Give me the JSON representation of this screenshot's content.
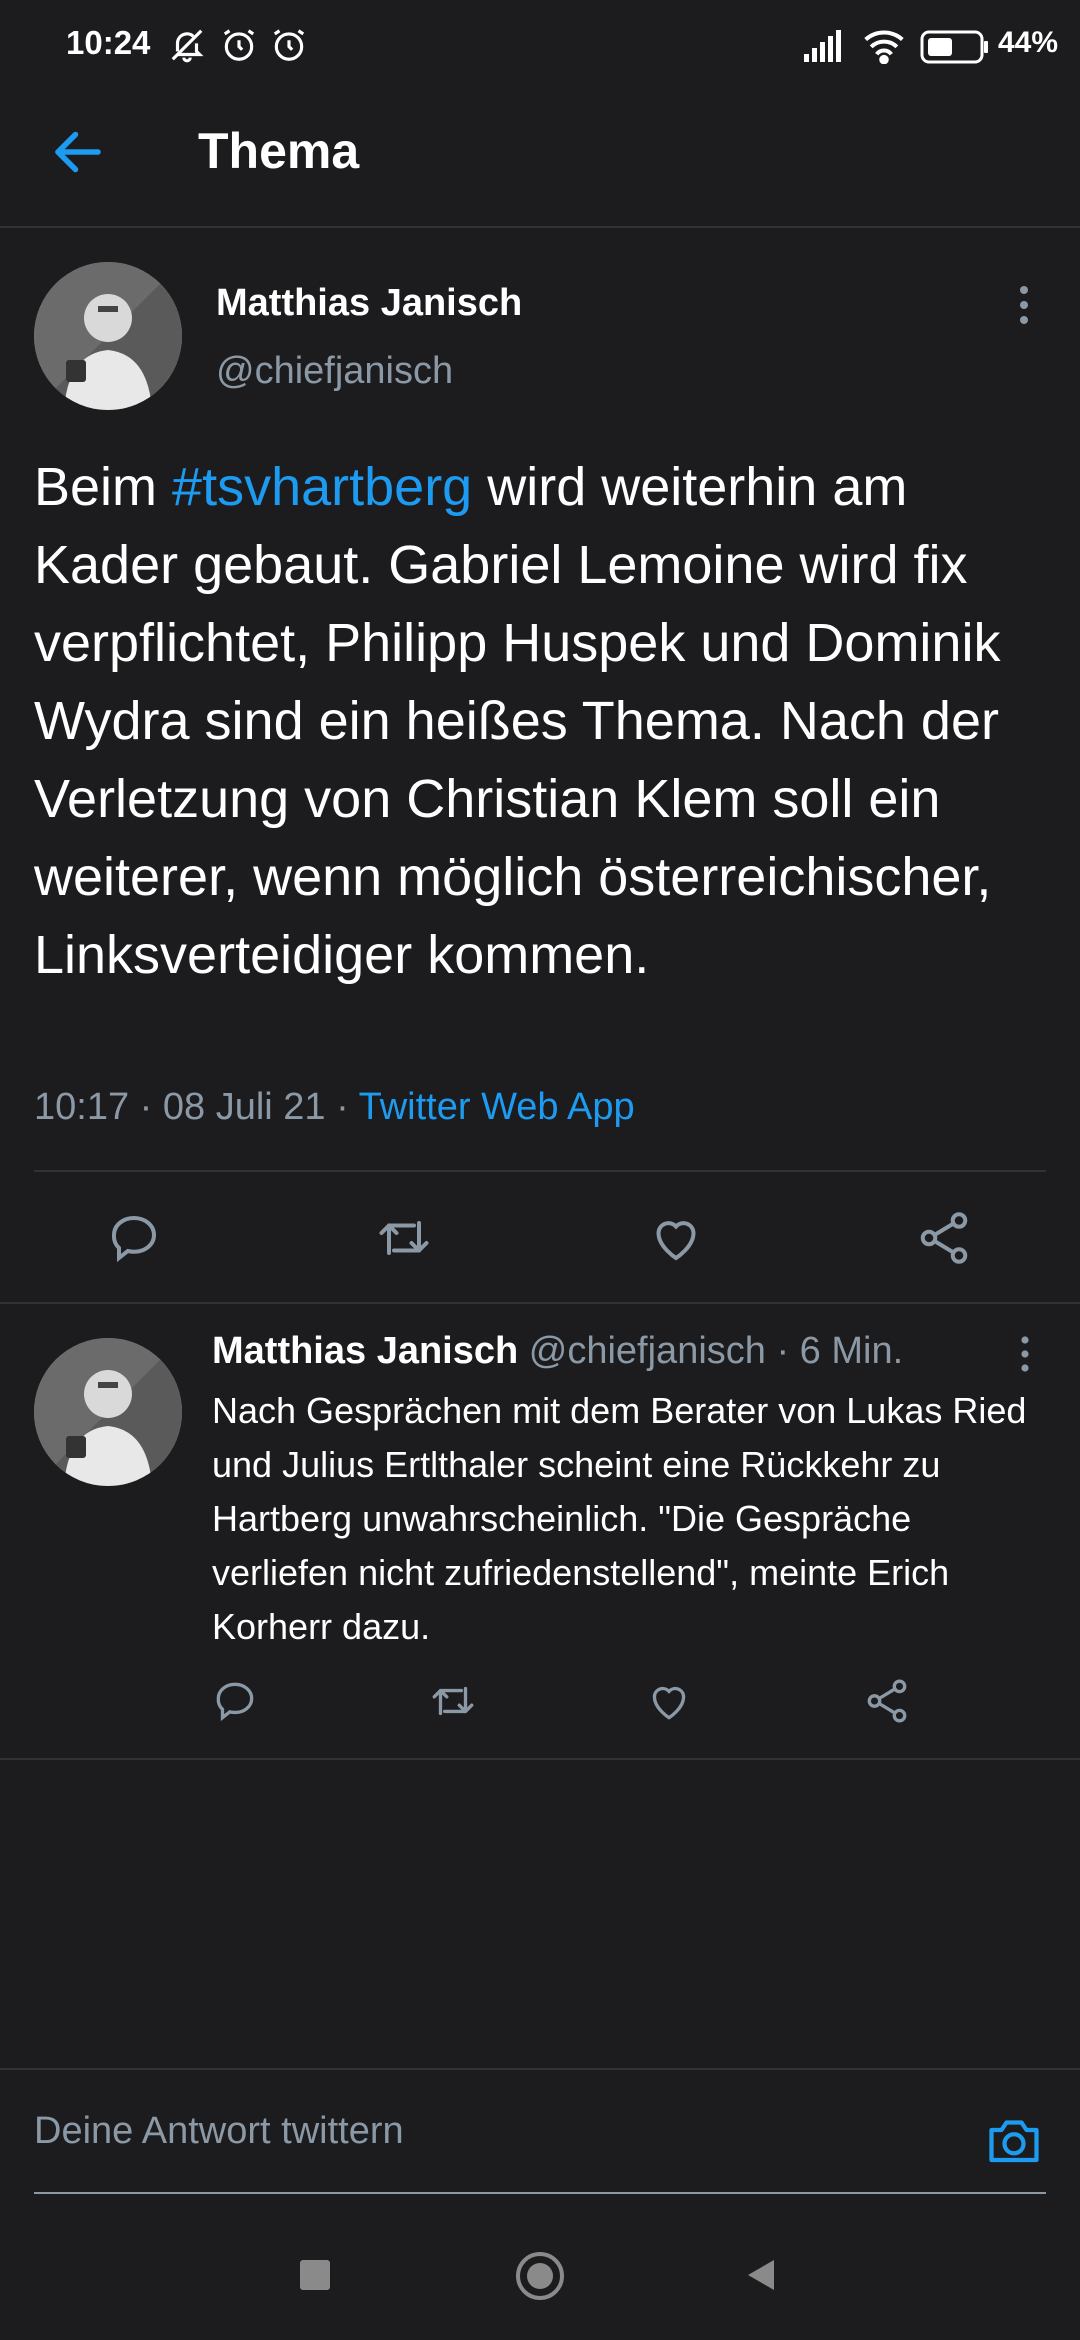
{
  "status_bar": {
    "time": "10:24",
    "battery_percent": "44%",
    "icons": [
      "notifications-off-icon",
      "alarm-icon",
      "alarm-icon",
      "signal-icon",
      "wifi-icon",
      "battery-icon"
    ]
  },
  "header": {
    "title": "Thema",
    "back_icon": "arrow-left-icon"
  },
  "main_tweet": {
    "author_name": "Matthias Janisch",
    "author_handle": "@chiefjanisch",
    "text_before": "Beim ",
    "hashtag": "#tsvhartberg",
    "text_after": " wird weiterhin am Kader gebaut. Gabriel Lemoine wird fix verpflichtet, Philipp Huspek und Dominik Wydra sind ein heißes Thema. Nach der Verletzung von Christian Klem soll ein weiterer, wenn möglich österreichischer, Linksverteidiger kommen.",
    "meta_time": "10:17 · 08 Juli 21 · ",
    "meta_app": "Twitter Web App",
    "actions": [
      "reply-icon",
      "retweet-icon",
      "like-icon",
      "share-icon"
    ]
  },
  "reply_tweet": {
    "author_name": "Matthias Janisch",
    "author_handle_time": " @chiefjanisch · 6 Min.",
    "text": "Nach Gesprächen mit dem Berater von Lukas Ried und Julius Ertlthaler scheint eine Rückkehr zu Hartberg unwahrscheinlich. \"Die Gespräche verliefen nicht zufriedenstellend\", meinte Erich Korherr dazu.",
    "actions": [
      "reply-icon",
      "retweet-icon",
      "like-icon",
      "share-icon"
    ]
  },
  "compose": {
    "placeholder": "Deine Antwort twittern",
    "value": ""
  },
  "colors": {
    "background": "#1c1c1e",
    "accent": "#1d9bf0",
    "secondary_text": "#8b98a5",
    "divider": "#2f3336"
  }
}
